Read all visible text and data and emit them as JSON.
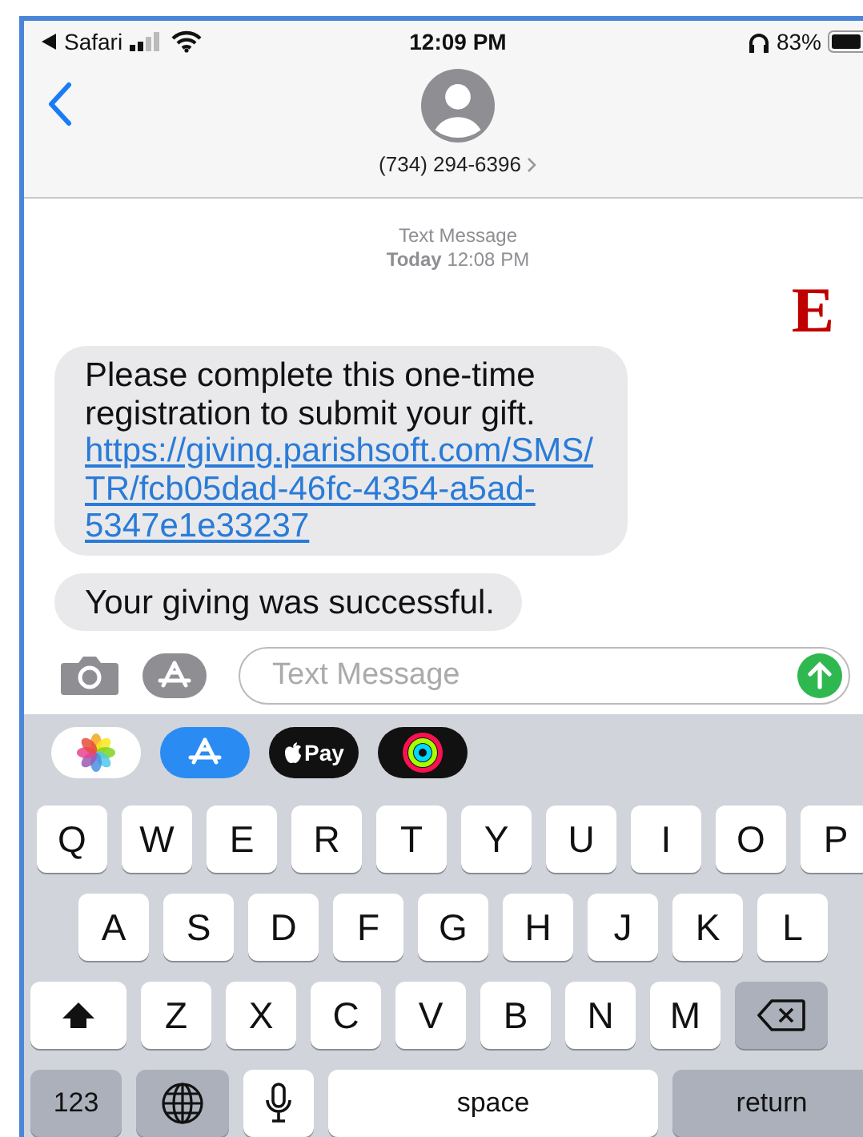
{
  "status_bar": {
    "back_app": "Safari",
    "time": "12:09 PM",
    "battery": "83%"
  },
  "header": {
    "contact": "(734) 294-6396"
  },
  "thread": {
    "service": "Text Message",
    "day": "Today",
    "time": "12:08 PM"
  },
  "figure_label": "E",
  "messages": [
    {
      "text": "Please complete this one-time registration to submit your gift.",
      "link": "https://giving.parishsoft.com/SMS/TR/fcb05dad-46fc-4354-a5ad-5347e1e33237"
    },
    {
      "text": "Your giving was successful."
    }
  ],
  "composer": {
    "placeholder": "Text Message"
  },
  "apps": [
    {
      "kind": "photos"
    },
    {
      "kind": "appstore"
    },
    {
      "kind": "pay",
      "label": "Pay"
    },
    {
      "kind": "activity"
    }
  ],
  "keyboard": [
    [
      {
        "kind": "letter",
        "label": "Q"
      },
      {
        "kind": "letter",
        "label": "W"
      },
      {
        "kind": "letter",
        "label": "E"
      },
      {
        "kind": "letter",
        "label": "R"
      },
      {
        "kind": "letter",
        "label": "T"
      },
      {
        "kind": "letter",
        "label": "Y"
      },
      {
        "kind": "letter",
        "label": "U"
      },
      {
        "kind": "letter",
        "label": "I"
      },
      {
        "kind": "letter",
        "label": "O"
      },
      {
        "kind": "letter",
        "label": "P"
      }
    ],
    [
      {
        "kind": "letter",
        "label": "A"
      },
      {
        "kind": "letter",
        "label": "S"
      },
      {
        "kind": "letter",
        "label": "D"
      },
      {
        "kind": "letter",
        "label": "F"
      },
      {
        "kind": "letter",
        "label": "G"
      },
      {
        "kind": "letter",
        "label": "H"
      },
      {
        "kind": "letter",
        "label": "J"
      },
      {
        "kind": "letter",
        "label": "K"
      },
      {
        "kind": "letter",
        "label": "L"
      }
    ],
    [
      {
        "kind": "shift"
      },
      {
        "kind": "letter",
        "label": "Z"
      },
      {
        "kind": "letter",
        "label": "X"
      },
      {
        "kind": "letter",
        "label": "C"
      },
      {
        "kind": "letter",
        "label": "V"
      },
      {
        "kind": "letter",
        "label": "B"
      },
      {
        "kind": "letter",
        "label": "N"
      },
      {
        "kind": "letter",
        "label": "M"
      },
      {
        "kind": "delete"
      }
    ],
    [
      {
        "kind": "numbers",
        "label": "123"
      },
      {
        "kind": "globe"
      },
      {
        "kind": "mic"
      },
      {
        "kind": "space",
        "label": "space"
      },
      {
        "kind": "return",
        "label": "return"
      }
    ]
  ]
}
